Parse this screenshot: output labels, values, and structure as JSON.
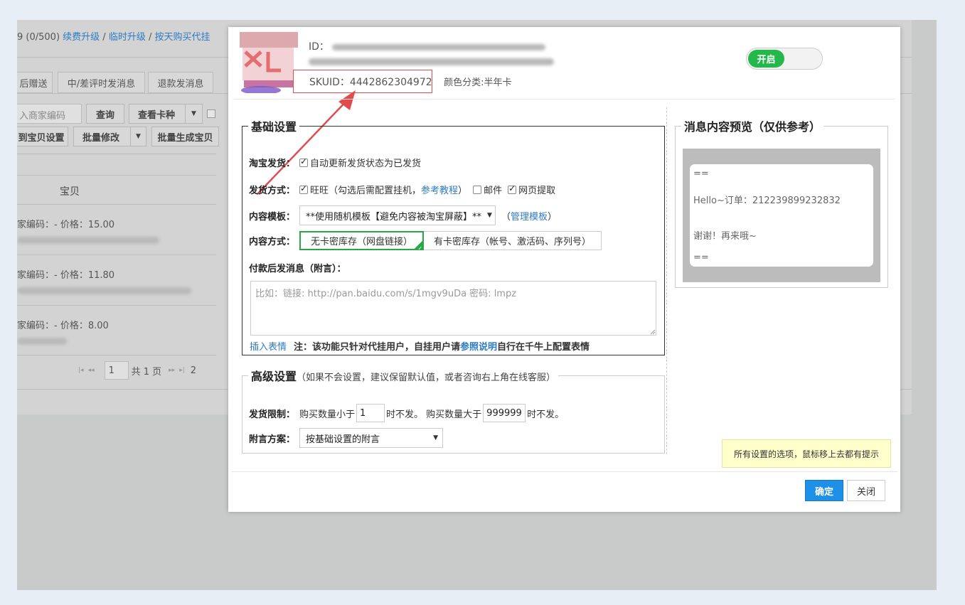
{
  "background": {
    "toolbar_text": "9  (0/500)",
    "links": [
      "续费升级",
      "临时升级",
      "按天购买代挂"
    ],
    "tabs": [
      "后赠送",
      "中/差评时发消息",
      "退款发消息"
    ],
    "search_placeholder": "入商家编码",
    "query_btn": "查询",
    "view_card_btn": "查看卡种",
    "set_item_btn": "到宝贝设置",
    "batch_edit_btn": "批量修改",
    "batch_gen_btn": "批量生成宝贝",
    "column_header": "宝贝",
    "items": [
      {
        "code_price": "家编码：-    价格：15.00"
      },
      {
        "code_price": "家编码：-    价格：11.80"
      },
      {
        "code_price": "家编码：-    价格：8.00"
      }
    ],
    "pagination": {
      "page": "1",
      "total": "共 1 页",
      "next_label": "2"
    }
  },
  "modal": {
    "header": {
      "line1_id": "ID：",
      "sku_label": "SKUID：4442862304972",
      "color_category": "颜色分类:半年卡"
    },
    "toggle_label": "开启",
    "basic": {
      "legend": "基础设置",
      "taobao_ship_label": "淘宝发货：",
      "taobao_ship_option": "自动更新发货状态为已发货",
      "ship_method_label": "发货方式：",
      "wangwang_option": "旺旺（勾选后需配置挂机，",
      "tutorial_link": "参考教程",
      "wangwang_close": "）",
      "mail_option": "邮件",
      "web_option": "网页提取",
      "template_label": "内容模板：",
      "template_value": "**使用随机模板【避免内容被淘宝屏蔽】**",
      "manage_open": "（",
      "manage_link": "管理模板",
      "manage_close": "）",
      "content_method_label": "内容方式：",
      "opt_no_card": "无卡密库存（网盘链接）",
      "opt_card": "有卡密库存（帐号、激活码、序列号）",
      "after_pay_label": "付款后发消息（附言）：",
      "textarea_placeholder": "比如：链接: http://pan.baidu.com/s/1mgv9uDa 密码: lmpz",
      "emoji_link": "插入表情",
      "note_prefix": "注：该功能只针对代挂用户，自挂用户请",
      "note_link": "参照说明",
      "note_suffix": "自行在千牛上配置表情"
    },
    "advanced": {
      "legend": "高级设置",
      "legend_note": "（如果不会设置，建议保留默认值，或者咨询右上角在线客服）",
      "limit_label": "发货限制：",
      "limit_text1": "购买数量小于",
      "min_value": "1",
      "limit_text2": "时不发。 购买数量大于",
      "max_value": "999999",
      "limit_text3": "时不发。",
      "scheme_label": "附言方案：",
      "scheme_value": "按基础设置的附言"
    },
    "preview": {
      "legend": "消息内容预览（仅供参考）",
      "line1": "==",
      "line2": "Hello~订单：212239899232832",
      "line3": "谢谢！再来哦~",
      "line4": "=="
    },
    "hint": "所有设置的选项，鼠标移上去都有提示",
    "ok_btn": "确定",
    "close_btn": "关闭"
  },
  "colors": {
    "accent": "#1e90e8",
    "green": "#23b84a",
    "annotation_red": "#e24b4b"
  }
}
